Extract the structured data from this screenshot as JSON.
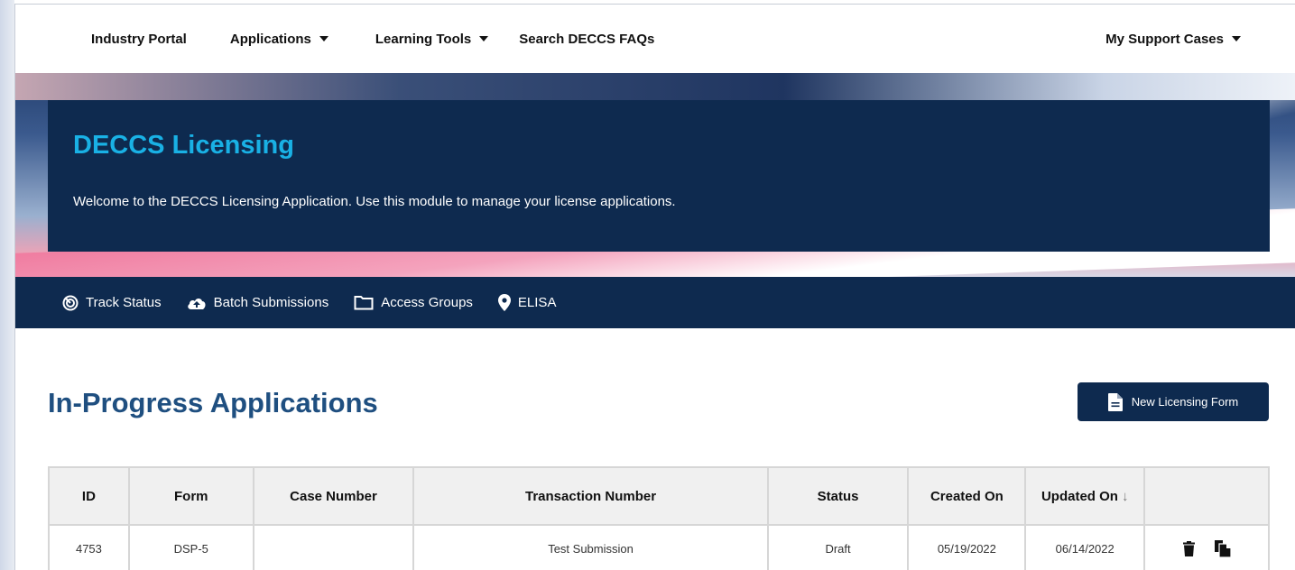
{
  "topnav": {
    "items": [
      {
        "label": "Industry Portal"
      },
      {
        "label": "Applications"
      },
      {
        "label": "Learning Tools"
      },
      {
        "label": "Search DECCS FAQs"
      }
    ],
    "right": {
      "label": "My Support Cases"
    }
  },
  "banner": {
    "title": "DECCS Licensing",
    "welcome": "Welcome to the DECCS Licensing Application. Use this module to manage your license applications."
  },
  "subnav": {
    "items": [
      {
        "label": "Track Status",
        "icon": "radar-icon"
      },
      {
        "label": "Batch Submissions",
        "icon": "cloud-upload-icon"
      },
      {
        "label": "Access Groups",
        "icon": "folder-icon"
      },
      {
        "label": "ELISA",
        "icon": "map-pin-icon"
      }
    ]
  },
  "main": {
    "heading": "In-Progress Applications",
    "new_button": "New Licensing Form"
  },
  "table": {
    "headers": [
      "ID",
      "Form",
      "Case Number",
      "Transaction Number",
      "Status",
      "Created On",
      "Updated On",
      ""
    ],
    "sort_indicator": "↓",
    "rows": [
      {
        "id": "4753",
        "form": "DSP-5",
        "case_number": "",
        "transaction_number": "Test Submission",
        "status": "Draft",
        "created_on": "05/19/2022",
        "updated_on": "06/14/2022"
      }
    ]
  },
  "colors": {
    "navy": "#0e2a4f",
    "title_cyan": "#19b1e5",
    "heading_blue": "#1f4f80"
  }
}
